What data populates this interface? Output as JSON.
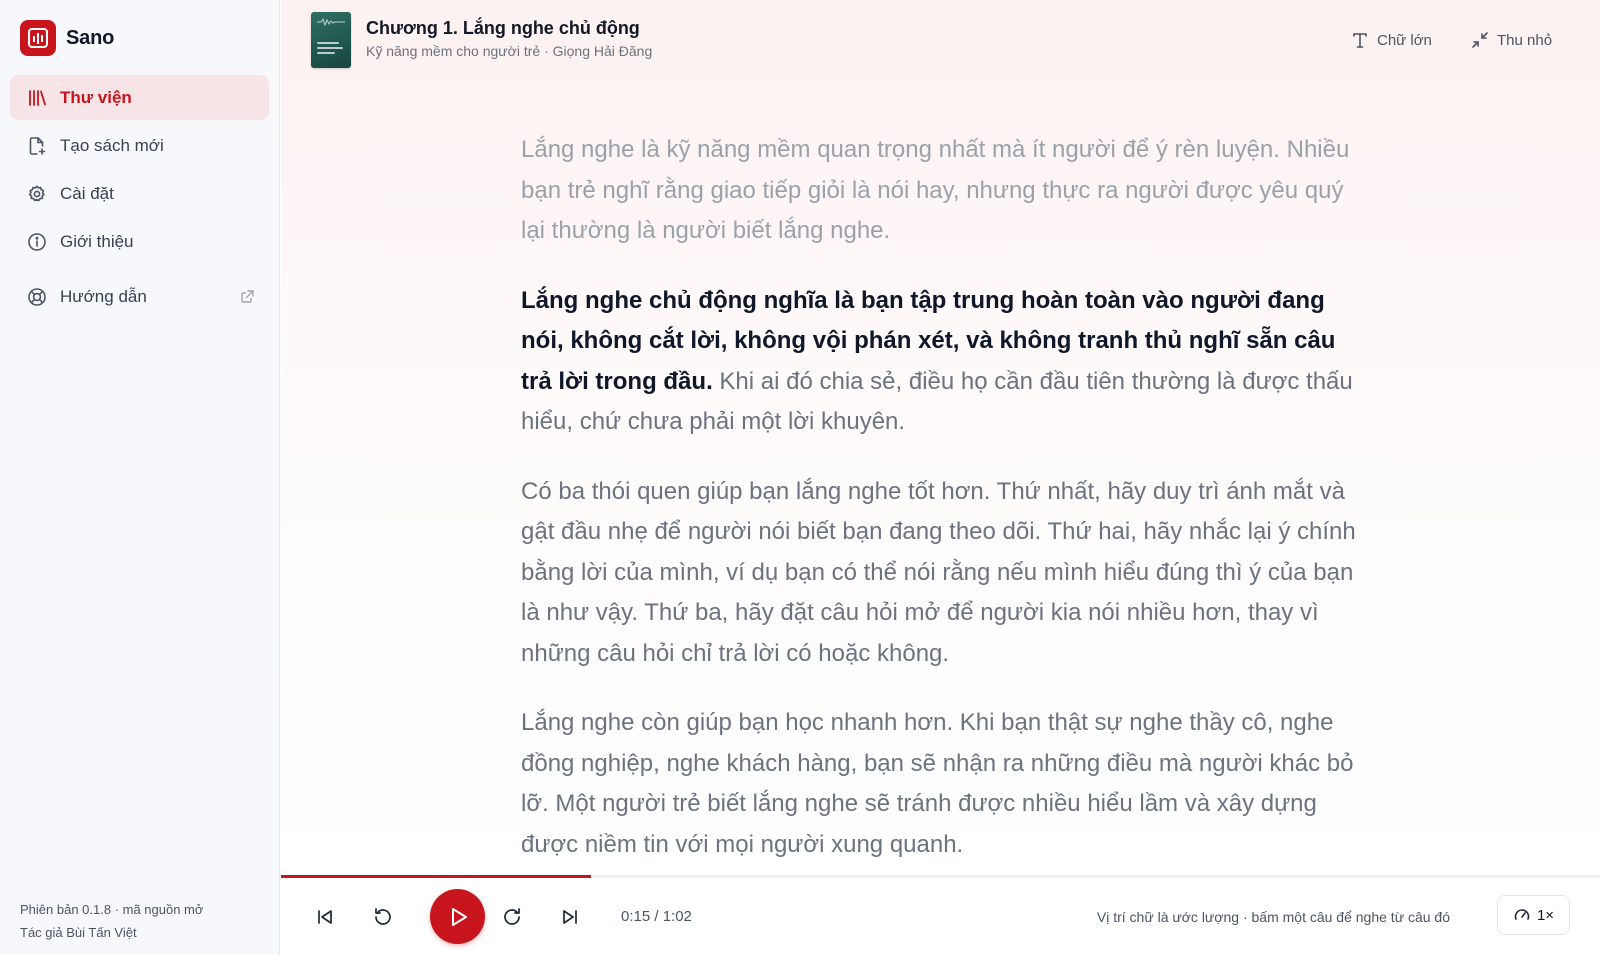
{
  "app": {
    "name": "Sano",
    "brand_color": "#c8141c"
  },
  "sidebar": {
    "items": [
      {
        "label": "Thư viện",
        "icon": "library-icon",
        "active": true
      },
      {
        "label": "Tạo sách mới",
        "icon": "new-file-icon"
      },
      {
        "label": "Cài đặt",
        "icon": "gear-icon"
      },
      {
        "label": "Giới thiệu",
        "icon": "info-icon"
      },
      {
        "label": "Hướng dẫn",
        "icon": "lifebuoy-icon",
        "external": true
      }
    ],
    "footer": {
      "version": "Phiên bản 0.1.8 · mã nguồn mở",
      "author": "Tác giả Bùi Tấn Việt"
    }
  },
  "header": {
    "chapter_title": "Chương 1. Lắng nghe chủ động",
    "subtitle": "Kỹ năng mềm cho người trẻ · Giọng Hải Đăng",
    "large_text_label": "Chữ lớn",
    "collapse_label": "Thu nhỏ"
  },
  "reader": {
    "p1": "Lắng nghe là kỹ năng mềm quan trọng nhất mà ít người để ý rèn luyện. Nhiều bạn trẻ nghĩ rằng giao tiếp giỏi là nói hay, nhưng thực ra người được yêu quý lại thường là người biết lắng nghe.",
    "p2_current": "Lắng nghe chủ động nghĩa là bạn tập trung hoàn toàn vào người đang nói, không cắt lời, không vội phán xét, và không tranh thủ nghĩ sẵn câu trả lời trong đầu.",
    "p2_rest": " Khi ai đó chia sẻ, điều họ cần đầu tiên thường là được thấu hiểu, chứ chưa phải một lời khuyên.",
    "p3": "Có ba thói quen giúp bạn lắng nghe tốt hơn. Thứ nhất, hãy duy trì ánh mắt và gật đầu nhẹ để người nói biết bạn đang theo dõi. Thứ hai, hãy nhắc lại ý chính bằng lời của mình, ví dụ bạn có thể nói rằng nếu mình hiểu đúng thì ý của bạn là như vậy. Thứ ba, hãy đặt câu hỏi mở để người kia nói nhiều hơn, thay vì những câu hỏi chỉ trả lời có hoặc không.",
    "p4": "Lắng nghe còn giúp bạn học nhanh hơn. Khi bạn thật sự nghe thầy cô, nghe đồng nghiệp, nghe khách hàng, bạn sẽ nhận ra những điều mà người khác bỏ lỡ. Một người trẻ biết lắng nghe sẽ tránh được nhiều hiểu lầm và xây dựng được niềm tin với mọi người xung quanh."
  },
  "player": {
    "time": "0:15 / 1:02",
    "progress": 0.235,
    "hint": "Vị trí chữ là ước lượng · bấm một câu để nghe từ câu đó",
    "speed": "1×"
  }
}
